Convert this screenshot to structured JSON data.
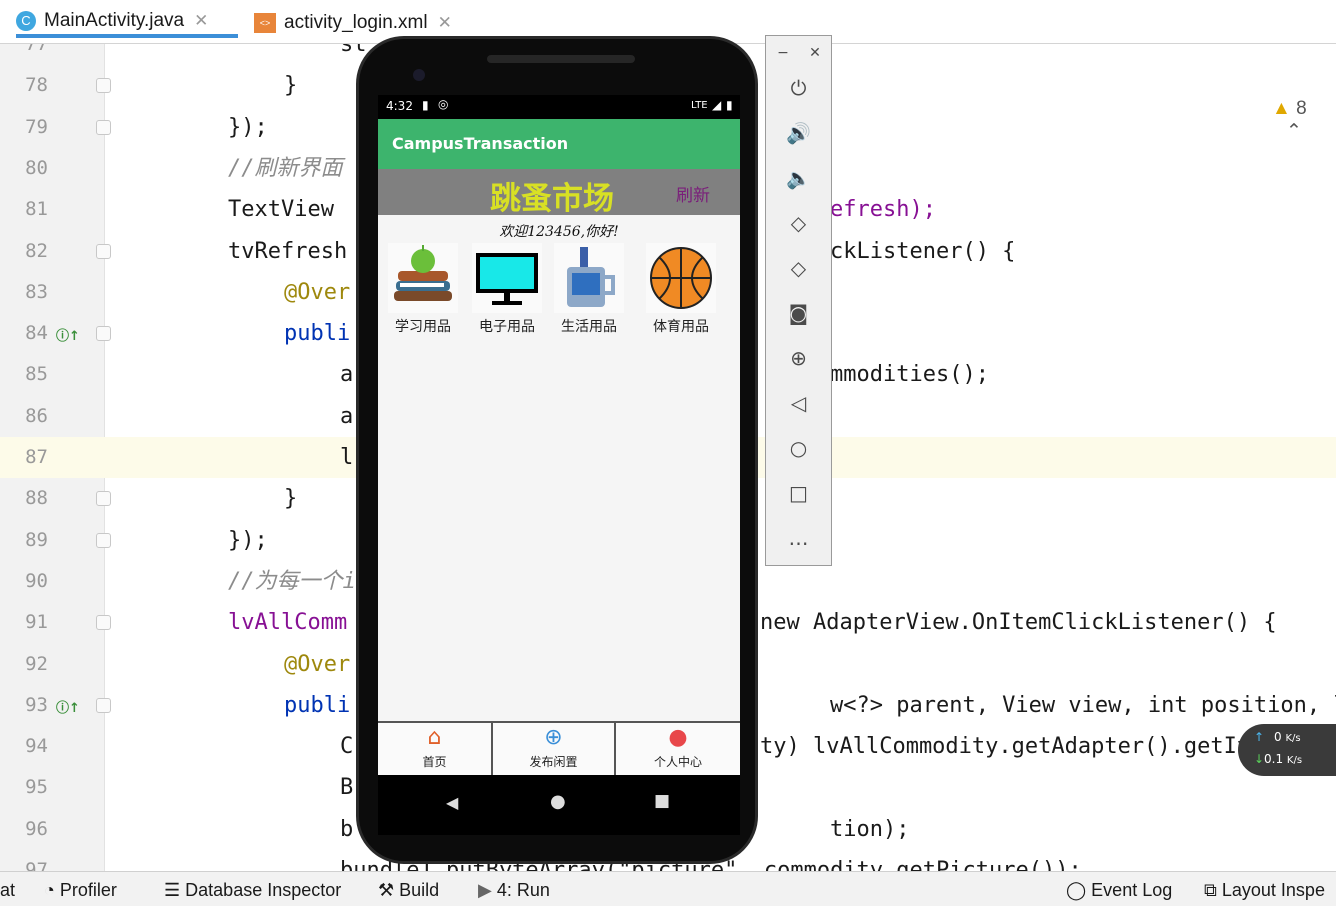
{
  "tabs": [
    {
      "label": "MainActivity.java",
      "icon": "java-class-icon",
      "active": true
    },
    {
      "label": "activity_login.xml",
      "icon": "xml-file-icon",
      "active": false
    }
  ],
  "warnings": {
    "count": "8"
  },
  "editor": {
    "lines": [
      {
        "num": "77",
        "text": "st"
      },
      {
        "num": "78",
        "text": "}"
      },
      {
        "num": "79",
        "text": "});"
      },
      {
        "num": "80",
        "text": "//刷新界面"
      },
      {
        "num": "81",
        "text": "TextView",
        "tail": "efresh);"
      },
      {
        "num": "82",
        "text": "tvRefresh",
        "tail": "ckListener() {"
      },
      {
        "num": "83",
        "text": "@Over"
      },
      {
        "num": "84",
        "text": "publi"
      },
      {
        "num": "85",
        "text": "a",
        "tail": "mmodities();"
      },
      {
        "num": "86",
        "text": "a"
      },
      {
        "num": "87",
        "text": "l"
      },
      {
        "num": "88",
        "text": "}"
      },
      {
        "num": "89",
        "text": "});"
      },
      {
        "num": "90",
        "text": "//为每一个i"
      },
      {
        "num": "91",
        "text": "lvAllComm",
        "tail": "new AdapterView.OnItemClickListener() {"
      },
      {
        "num": "92",
        "text": "@Over"
      },
      {
        "num": "93",
        "text": "publi",
        "tail": "w<?> parent, View view, int position, lon"
      },
      {
        "num": "94",
        "text": "C",
        "tail": "ty) lvAllCommodity.getAdapter().getItem"
      },
      {
        "num": "95",
        "text": "B"
      },
      {
        "num": "96",
        "text": "b",
        "tail": "tion);"
      },
      {
        "num": "97",
        "text": "bundle1.putByteArray(\"picture\", commodity.getPicture());"
      }
    ]
  },
  "statusbar": {
    "items": [
      "at",
      "Profiler",
      "Database Inspector",
      "Build",
      "4: Run",
      "Event Log",
      "Layout Inspe"
    ]
  },
  "phone": {
    "time": "4:32",
    "network": "LTE",
    "app_title": "CampusTransaction",
    "market_title": "跳蚤市场",
    "refresh": "刷新",
    "welcome": "欢迎123456,你好!",
    "categories": [
      {
        "label": "学习用品",
        "icon": "books-apple-icon"
      },
      {
        "label": "电子用品",
        "icon": "monitor-icon"
      },
      {
        "label": "生活用品",
        "icon": "mug-toothbrush-icon"
      },
      {
        "label": "体育用品",
        "icon": "basketball-icon"
      }
    ],
    "bottom_nav": [
      {
        "label": "首页",
        "icon": "home-icon"
      },
      {
        "label": "发布闲置",
        "icon": "add-circle-icon"
      },
      {
        "label": "个人中心",
        "icon": "user-icon"
      }
    ]
  },
  "emulator_toolbar": {
    "items": [
      "minimize-icon",
      "close-icon",
      "power-icon",
      "volume-up-icon",
      "volume-down-icon",
      "rotate-left-icon",
      "rotate-right-icon",
      "camera-icon",
      "zoom-icon",
      "back-icon",
      "home-icon",
      "overview-icon",
      "more-icon"
    ]
  },
  "net_widget": {
    "up": "0",
    "down": "0.1",
    "unit": "K/s"
  }
}
